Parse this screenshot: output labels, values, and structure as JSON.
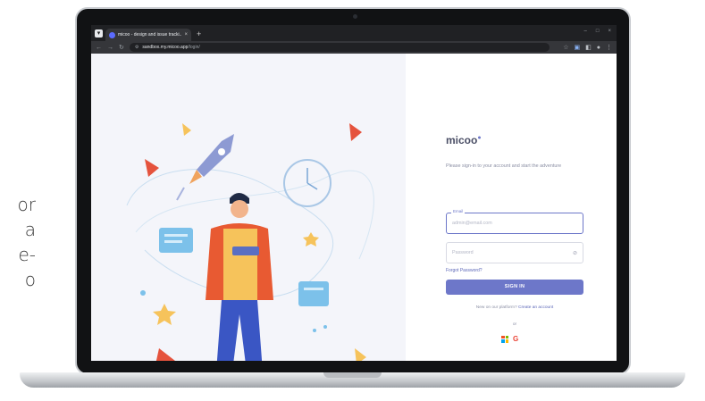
{
  "side_text": {
    "lines": [
      "or",
      "a",
      "e-",
      "o"
    ]
  },
  "browser": {
    "tab_title": "micoo - design and issue tracki...",
    "tab_close": "×",
    "new_tab": "+",
    "url_host": "sandbox.my.micoo.app",
    "url_path": "/login/",
    "window_controls": [
      "–",
      "□",
      "×"
    ],
    "icons": [
      "back-arrow-icon",
      "forward-arrow-icon",
      "reload-icon",
      "site-settings-icon",
      "bookmark-star-icon",
      "extensions-icon"
    ]
  },
  "login": {
    "brand": "micoo",
    "intro": "Please sign-in to your account and start the adventure",
    "email_label": "Email",
    "email_placeholder": "admin@email.com",
    "password_placeholder": "Password",
    "forgot": "Forgot Password?",
    "signin": "SIGN IN",
    "new_text": "New on our platform?",
    "create_link": "Create an account",
    "or": "or",
    "social": [
      "microsoft-icon",
      "google-icon"
    ]
  },
  "colors": {
    "accent": "#6d77c9",
    "illustration_bg": "#f4f5fa",
    "triangle_red": "#e5533d",
    "star_yellow": "#f6c35b"
  }
}
